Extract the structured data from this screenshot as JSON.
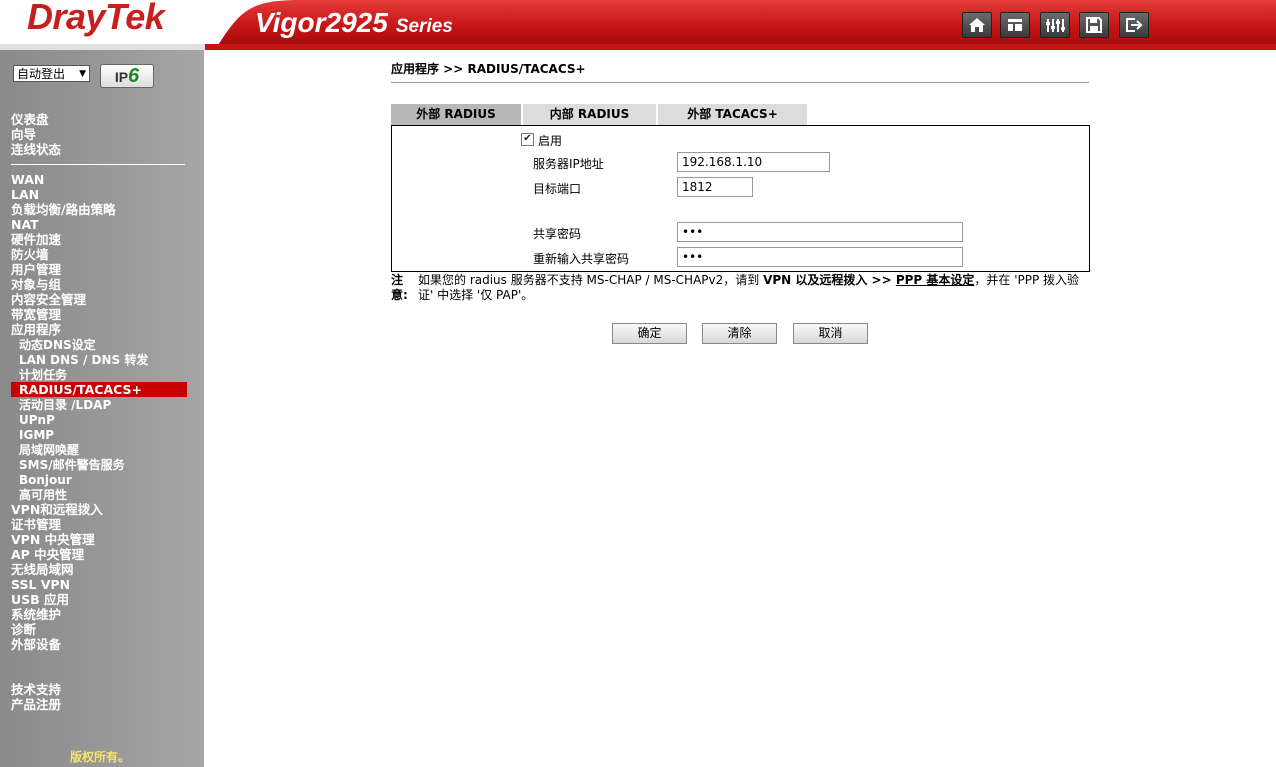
{
  "header": {
    "logo": "DrayTek",
    "model": "Vigor2925",
    "series": "Series",
    "icons": [
      "home-icon",
      "quick-start-icon",
      "settings-icon",
      "save-icon",
      "logout-icon"
    ]
  },
  "sidebar": {
    "login_select": "自动登出",
    "ipv6_badge": "IPv6",
    "items": [
      "仪表盘",
      "向导",
      "连线状态",
      "WAN",
      "LAN",
      "负载均衡/路由策略",
      "NAT",
      "硬件加速",
      "防火墙",
      "用户管理",
      "对象与组",
      "内容安全管理",
      "带宽管理",
      "应用程序",
      "动态DNS设定",
      "LAN DNS / DNS 转发",
      "计划任务",
      "RADIUS/TACACS+",
      "活动目录 /LDAP",
      "UPnP",
      "IGMP",
      "局域网唤醒",
      "SMS/邮件警告服务",
      "Bonjour",
      "高可用性",
      "VPN和远程拨入",
      "证书管理",
      "VPN 中央管理",
      "AP 中央管理",
      "无线局域网",
      "SSL VPN",
      "USB 应用",
      "系统维护",
      "诊断",
      "外部设备",
      "技术支持",
      "产品注册"
    ],
    "active_item": "RADIUS/TACACS+",
    "copyright": "版权所有。"
  },
  "main": {
    "breadcrumb": "应用程序 >> RADIUS/TACACS+",
    "tabs": [
      "外部 RADIUS",
      "内部 RADIUS",
      "外部 TACACS+"
    ],
    "active_tab": "外部 RADIUS",
    "form": {
      "enable_label": "启用",
      "enable_checked": true,
      "server_ip_label": "服务器IP地址",
      "server_ip_value": "192.168.1.10",
      "port_label": "目标端口",
      "port_value": "1812",
      "secret_label": "共享密码",
      "secret_value": "•••",
      "confirm_label": "重新输入共享密码",
      "confirm_value": "•••"
    },
    "note": {
      "label": "注意:",
      "text_1": "如果您的 radius 服务器不支持 MS-CHAP / MS-CHAPv2，请到 ",
      "text_bold": "VPN 以及远程拨入 >> ",
      "text_link": "PPP 基本设定",
      "text_2": "，并在 'PPP 拨入验证' 中选择 '仅 PAP'。"
    },
    "buttons": {
      "ok": "确定",
      "clear": "清除",
      "cancel": "取消"
    }
  },
  "colors": {
    "brand_red": "#c81e1e",
    "active_nav": "#c80000",
    "sidebar_gray": "#9a9a9a"
  }
}
